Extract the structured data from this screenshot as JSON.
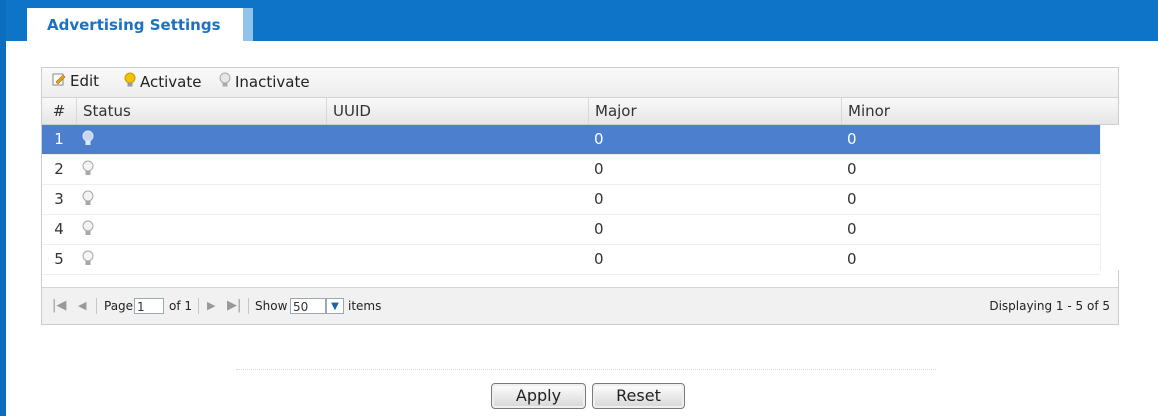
{
  "tab": {
    "label": "Advertising Settings"
  },
  "toolbar": {
    "edit": "Edit",
    "activate": "Activate",
    "inactivate": "Inactivate"
  },
  "columns": {
    "num": "#",
    "status": "Status",
    "uuid": "UUID",
    "major": "Major",
    "minor": "Minor"
  },
  "rows": [
    {
      "num": "1",
      "status_icon": "bulb-inactive-icon",
      "uuid": "",
      "major": "0",
      "minor": "0",
      "selected": true
    },
    {
      "num": "2",
      "status_icon": "bulb-inactive-icon",
      "uuid": "",
      "major": "0",
      "minor": "0",
      "selected": false
    },
    {
      "num": "3",
      "status_icon": "bulb-inactive-icon",
      "uuid": "",
      "major": "0",
      "minor": "0",
      "selected": false
    },
    {
      "num": "4",
      "status_icon": "bulb-inactive-icon",
      "uuid": "",
      "major": "0",
      "minor": "0",
      "selected": false
    },
    {
      "num": "5",
      "status_icon": "bulb-inactive-icon",
      "uuid": "",
      "major": "0",
      "minor": "0",
      "selected": false
    }
  ],
  "pager": {
    "page_label": "Page",
    "page_value": "1",
    "of_label": "of 1",
    "show_label": "Show",
    "show_value": "50",
    "items_label": "items",
    "displaying": "Displaying 1 - 5 of 5"
  },
  "buttons": {
    "apply": "Apply",
    "reset": "Reset"
  },
  "colors": {
    "header_blue": "#0d74c8",
    "selected_row": "#4d7fcf",
    "bulb_active": "#f2c200",
    "bulb_inactive": "#a8a8a8"
  }
}
